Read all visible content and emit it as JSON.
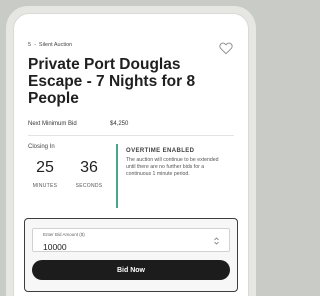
{
  "breadcrumb": {
    "lot": "5",
    "separator": "-",
    "category": "Silent Auction"
  },
  "item": {
    "title": "Private Port Douglas Escape - 7 Nights for 8 People",
    "next_minimum_label": "Next Minimum Bid",
    "next_minimum_value": "$4,250"
  },
  "closing": {
    "label": "Closing In",
    "minutes_value": "25",
    "minutes_label": "MINUTES",
    "seconds_value": "36",
    "seconds_label": "SECONDS"
  },
  "overtime": {
    "title": "OVERTIME ENABLED",
    "body": "The auction will continue to be extended until there are no further bids for a continuous 1 minute period."
  },
  "bid": {
    "field_label": "Enter Bid Amount ($)",
    "value": "10000",
    "button_label": "Bid Now"
  },
  "colors": {
    "accent_teal": "#4aa58c",
    "button_dark": "#1c1c1c"
  },
  "icons": {
    "favorite": "heart-outline-icon",
    "stepper": "stepper-arrows-icon"
  }
}
